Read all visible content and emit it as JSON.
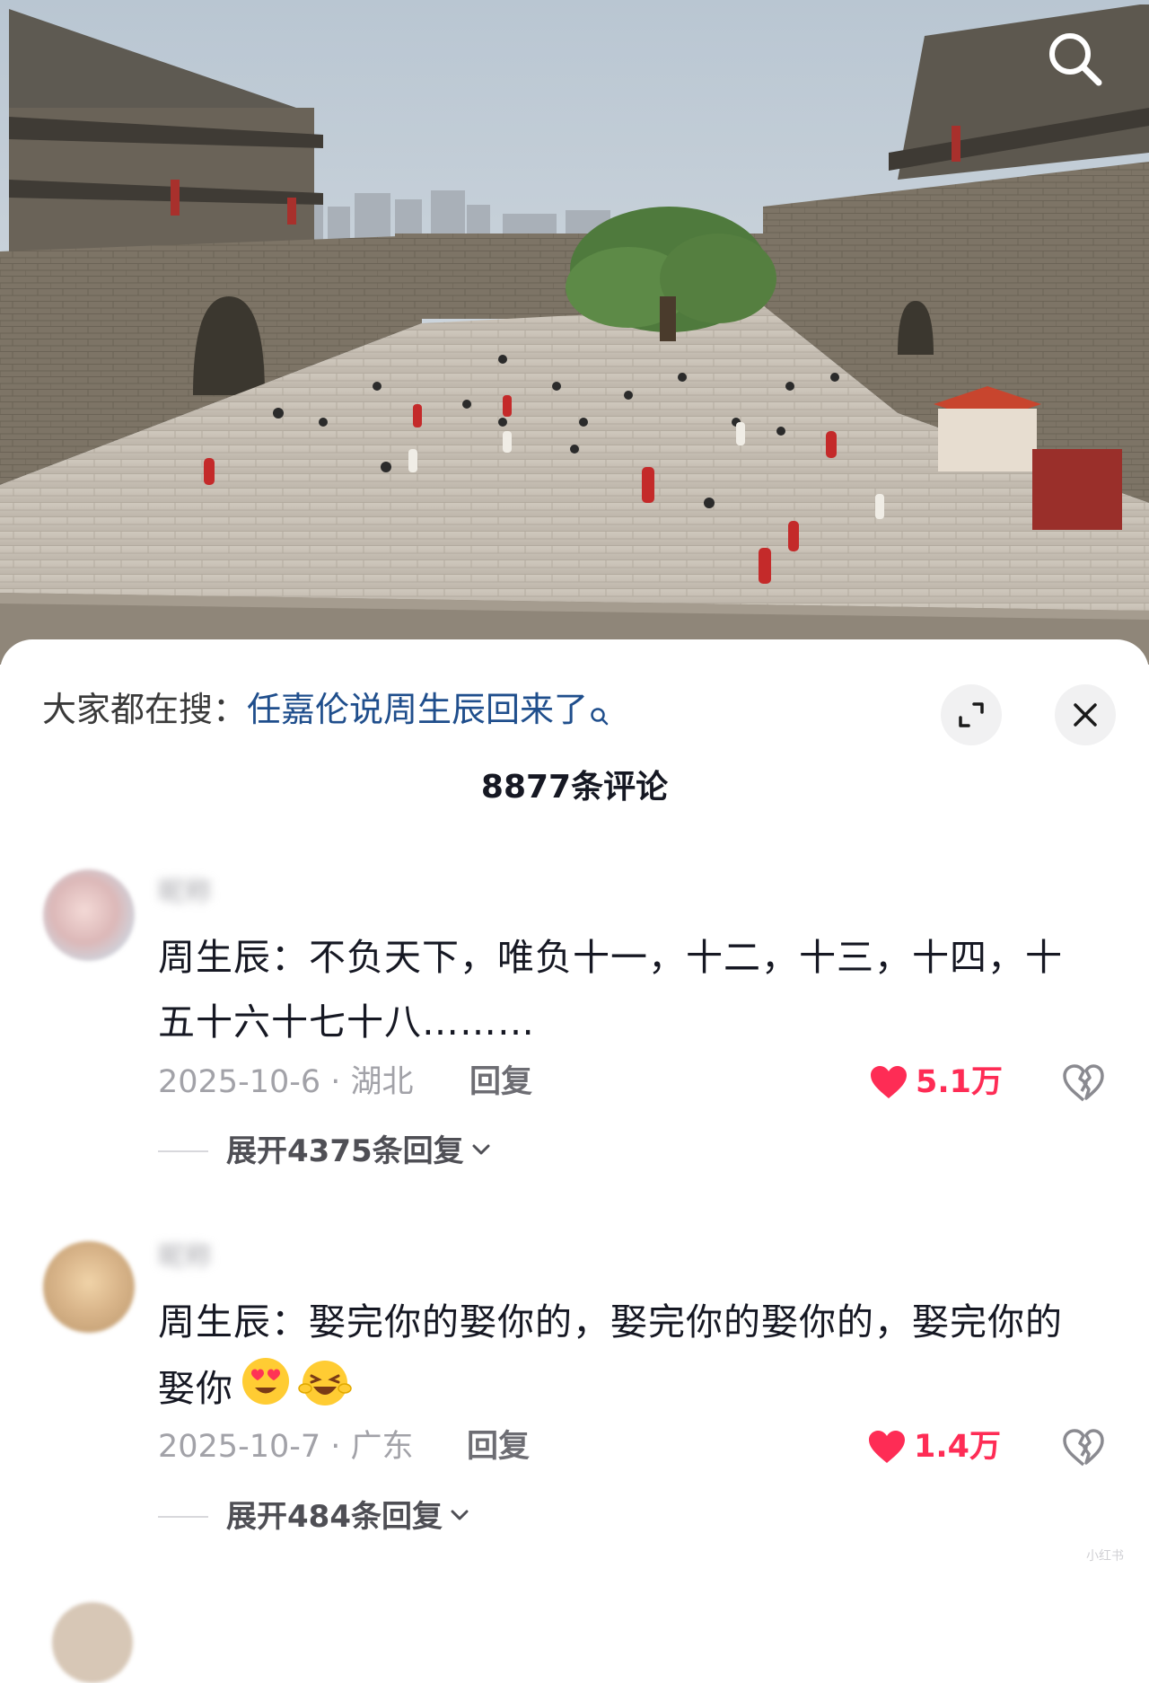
{
  "photo": {
    "description_icon": "search-icon"
  },
  "sheet": {
    "suggest_prefix": "大家都在搜：",
    "suggest_query": "任嘉伦说周生辰回来了",
    "search_suggest_icon": "search-icon",
    "expand_icon": "expand-icon",
    "close_icon": "close-icon",
    "comment_count_title": "8877条评论"
  },
  "comments": [
    {
      "username": "昵称",
      "content": "周生辰：不负天下，唯负十一，十二，十三，十四，十五十六十七十八………",
      "date_location": "2025-10-6 · 湖北",
      "reply_label": "回复",
      "likes": "5.1万",
      "liked": true,
      "expand_replies": "展开4375条回复"
    },
    {
      "username": "昵称",
      "content": "周生辰：娶完你的娶你的，娶完你的娶你的，娶完你的娶你",
      "emojis": [
        "heart-eyes-emoji",
        "laughing-emoji"
      ],
      "date_location": "2025-10-7 · 广东",
      "reply_label": "回复",
      "likes": "1.4万",
      "liked": true,
      "expand_replies": "展开484条回复"
    }
  ],
  "colors": {
    "accent_like": "#fe2c55",
    "query_link": "#1f4e8c",
    "text_primary": "#161823",
    "text_secondary": "#a2a2a8"
  },
  "watermark": "小红书"
}
